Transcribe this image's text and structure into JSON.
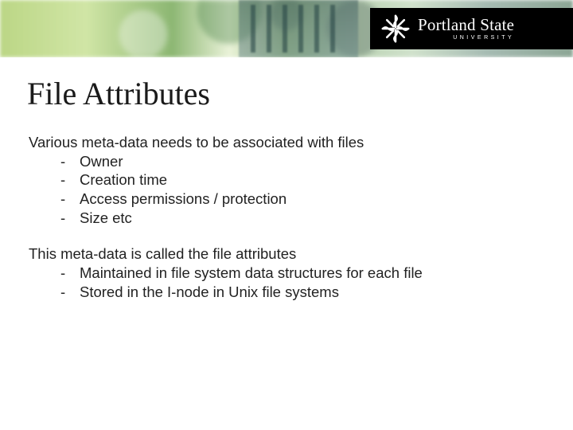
{
  "logo": {
    "main": "Portland State",
    "sub": "UNIVERSITY"
  },
  "title": "File Attributes",
  "section1": {
    "intro": "Various meta-data needs to be associated with files",
    "items": [
      "Owner",
      "Creation time",
      "Access permissions / protection",
      "Size etc"
    ]
  },
  "section2": {
    "intro": "This meta-data is called the file attributes",
    "items": [
      "Maintained in file system data structures for each file",
      "Stored in the I-node in Unix file systems"
    ]
  }
}
